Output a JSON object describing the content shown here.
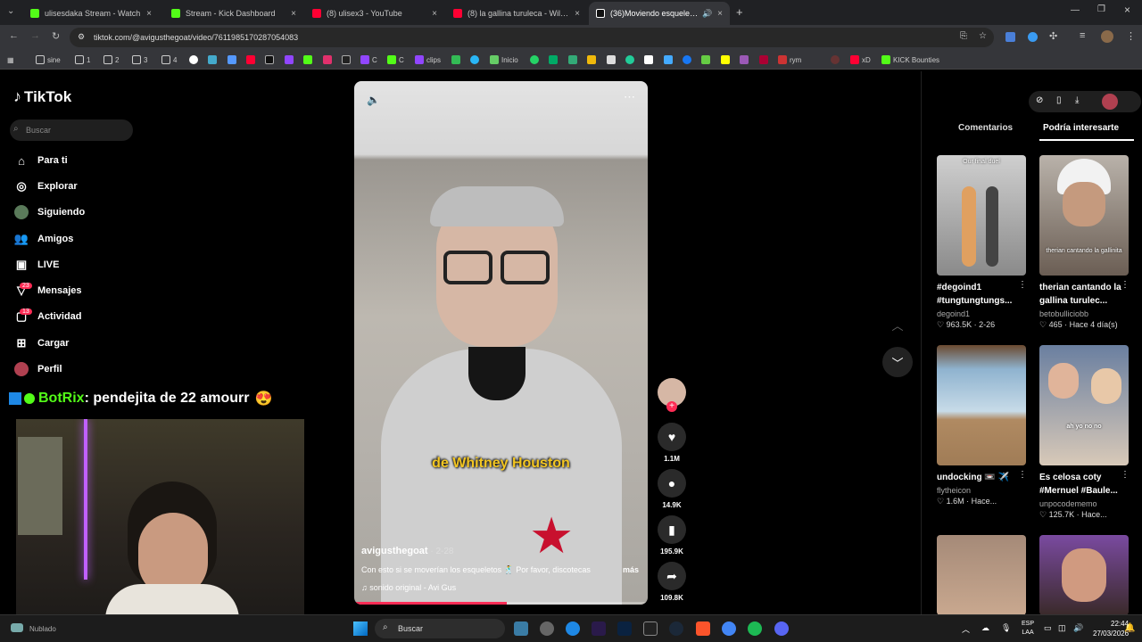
{
  "browser": {
    "tabs": [
      {
        "label": "ulisesdaka Stream - Watch",
        "color": "#53fc18"
      },
      {
        "label": "Stream - Kick Dashboard",
        "color": "#53fc18"
      },
      {
        "label": "(8) ulisex3 - YouTube",
        "color": "#ff0033"
      },
      {
        "label": "(8) la gallina turuleca - Will y Ra",
        "color": "#ff0033"
      },
      {
        "label": "(36)Moviendo esqueletos c",
        "color": "#ffffff"
      }
    ],
    "url": "tiktok.com/@avigusthegoat/video/7611985170287054083",
    "bookmarks": [
      "sine",
      "1",
      "2",
      "3",
      "4",
      "C",
      "C",
      "clips",
      "Inicio",
      "rym",
      "xD",
      "KICK Bounties"
    ]
  },
  "tiktok": {
    "logo": "TikTok",
    "search_placeholder": "Buscar",
    "nav": [
      {
        "label": "Para ti",
        "icon": "home-icon"
      },
      {
        "label": "Explorar",
        "icon": "compass-icon"
      },
      {
        "label": "Siguiendo",
        "icon": "following-icon"
      },
      {
        "label": "Amigos",
        "icon": "friends-icon"
      },
      {
        "label": "LIVE",
        "icon": "live-icon"
      },
      {
        "label": "Mensajes",
        "icon": "message-icon",
        "badge": "23"
      },
      {
        "label": "Actividad",
        "icon": "activity-icon",
        "badge": "13"
      },
      {
        "label": "Cargar",
        "icon": "upload-icon"
      },
      {
        "label": "Perfil",
        "icon": "profile-icon"
      }
    ],
    "chat_overlay": {
      "user": "BotRix",
      "message": ": pendejita de 22 amourr"
    },
    "video": {
      "caption": "de Whitney Houston",
      "author": "avigusthegoat",
      "date": " · 2-28",
      "description": "Con esto si se moverían los esqueletos 🕺 Por favor, discotecas",
      "more": "más",
      "sound": "sonido original - Avi Gus",
      "progress_percent": 52
    },
    "actions": {
      "likes": "1.1M",
      "comments": "14.9K",
      "saves": "195.9K",
      "shares": "109.8K"
    },
    "right_tabs": [
      "Comentarios",
      "Podría interesarte"
    ],
    "recommendations": [
      {
        "title": "#degoind1 #tungtungtungs...",
        "author": "degoind1",
        "stats": "♡ 963.5K · 2-26",
        "overlay": "Our final duel"
      },
      {
        "title": "therian cantando la gallina turulec...",
        "author": "betobulliciobb",
        "stats": "♡ 465 · Hace 4 día(s)",
        "overlay": "therian cantando la gallinita"
      },
      {
        "title": "undocking 📼 ✈️",
        "author": "flytheicon",
        "stats": "♡ 1.6M · Hace...",
        "overlay": ""
      },
      {
        "title": "Es celosa coty #Mernuel #Baule...",
        "author": "unpocodememo",
        "stats": "♡ 125.7K · Hace...",
        "overlay": "ah yo no no"
      },
      {
        "title": "",
        "author": "",
        "stats": "",
        "overlay": ""
      },
      {
        "title": "",
        "author": "",
        "stats": "",
        "overlay": ""
      }
    ]
  },
  "taskbar": {
    "weather": "Nublado",
    "search": "Buscar",
    "lang": "ESP",
    "lang2": "LAA",
    "time": "22:44",
    "date": "27/03/2026"
  }
}
